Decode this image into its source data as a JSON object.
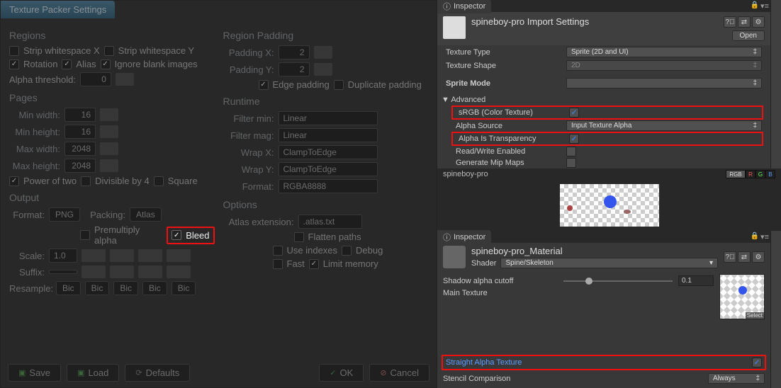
{
  "spine": {
    "title": "Texture Packer Settings",
    "regions": {
      "title": "Regions",
      "strip_ws_x": "Strip whitespace X",
      "strip_ws_y": "Strip whitespace Y",
      "rotation": "Rotation",
      "alias": "Alias",
      "ignore_blank": "Ignore blank images",
      "alpha_threshold_label": "Alpha threshold:",
      "alpha_threshold": "0"
    },
    "pages": {
      "title": "Pages",
      "min_width_label": "Min width:",
      "min_width": "16",
      "min_height_label": "Min height:",
      "min_height": "16",
      "max_width_label": "Max width:",
      "max_width": "2048",
      "max_height_label": "Max height:",
      "max_height": "2048",
      "power_of_two": "Power of two",
      "divisible_by_4": "Divisible by 4",
      "square": "Square"
    },
    "output": {
      "title": "Output",
      "format_label": "Format:",
      "format": "PNG",
      "packing_label": "Packing:",
      "packing": "Atlas",
      "premultiply": "Premultiply alpha",
      "bleed": "Bleed",
      "scale_label": "Scale:",
      "scale": "1.0",
      "suffix_label": "Suffix:",
      "resample_label": "Resample:",
      "resample": "Bic"
    },
    "padding": {
      "title": "Region Padding",
      "padding_x_label": "Padding X:",
      "padding_x": "2",
      "padding_y_label": "Padding Y:",
      "padding_y": "2",
      "edge_padding": "Edge padding",
      "duplicate_padding": "Duplicate padding"
    },
    "runtime": {
      "title": "Runtime",
      "filter_min_label": "Filter min:",
      "filter_min": "Linear",
      "filter_mag_label": "Filter mag:",
      "filter_mag": "Linear",
      "wrap_x_label": "Wrap X:",
      "wrap_x": "ClampToEdge",
      "wrap_y_label": "Wrap Y:",
      "wrap_y": "ClampToEdge",
      "format_label": "Format:",
      "format": "RGBA8888"
    },
    "options": {
      "title": "Options",
      "atlas_ext_label": "Atlas extension:",
      "atlas_ext": ".atlas.txt",
      "flatten_paths": "Flatten paths",
      "use_indexes": "Use indexes",
      "debug": "Debug",
      "fast": "Fast",
      "limit_memory": "Limit memory"
    },
    "buttons": {
      "save": "Save",
      "load": "Load",
      "defaults": "Defaults",
      "ok": "OK",
      "cancel": "Cancel"
    }
  },
  "unity": {
    "inspector_tab": "Inspector",
    "import": {
      "title": "spineboy-pro Import Settings",
      "open": "Open",
      "texture_type_label": "Texture Type",
      "texture_type": "Sprite (2D and UI)",
      "texture_shape_label": "Texture Shape",
      "texture_shape": "2D",
      "sprite_mode_label": "Sprite Mode",
      "advanced": "Advanced",
      "srgb": "sRGB (Color Texture)",
      "alpha_source_label": "Alpha Source",
      "alpha_source": "Input Texture Alpha",
      "alpha_transparency": "Alpha Is Transparency",
      "rw_enabled": "Read/Write Enabled",
      "mip_maps": "Generate Mip Maps"
    },
    "preview": {
      "name": "spineboy-pro",
      "rgb": "RGB",
      "r": "R",
      "g": "G",
      "b": "B"
    },
    "material": {
      "title": "spineboy-pro_Material",
      "shader_label": "Shader",
      "shader": "Spine/Skeleton",
      "shadow_cutoff_label": "Shadow alpha cutoff",
      "shadow_cutoff": "0.1",
      "main_tex_label": "Main Texture",
      "select": "Select",
      "straight_alpha": "Straight Alpha Texture",
      "stencil_label": "Stencil Comparison",
      "stencil": "Always"
    }
  }
}
